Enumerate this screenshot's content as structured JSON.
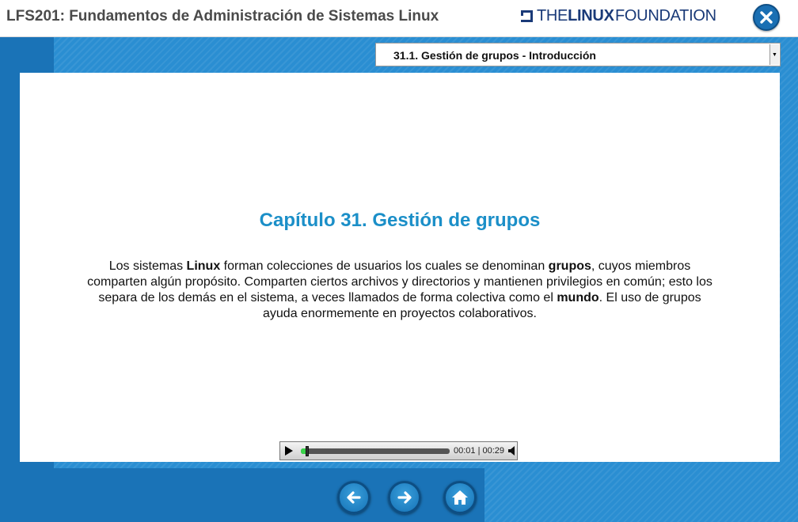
{
  "header": {
    "course_title": "LFS201: Fundamentos de Administración de Sistemas Linux",
    "logo": {
      "prefix": "THE",
      "brand": "LINUX",
      "suffix": "FOUNDATION"
    },
    "close_icon": "close-icon"
  },
  "section_select": {
    "selected": "31.1. Gestión de grupos - Introducción"
  },
  "content": {
    "chapter_title": "Capítulo 31. Gestión de grupos",
    "paragraph": [
      {
        "text": "Los sistemas ",
        "bold": false
      },
      {
        "text": "Linux",
        "bold": true
      },
      {
        "text": " forman colecciones de usuarios los cuales se denominan ",
        "bold": false
      },
      {
        "text": "grupos",
        "bold": true
      },
      {
        "text": ", cuyos miembros comparten algún propósito. Comparten ciertos archivos y directorios y mantienen privilegios en común; esto los separa de los demás en el sistema, a veces llamados de forma colectiva como el ",
        "bold": false
      },
      {
        "text": "mundo",
        "bold": true
      },
      {
        "text": ". El uso de grupos ayuda enormemente en proyectos colaborativos.",
        "bold": false
      }
    ]
  },
  "audio_player": {
    "current_time": "00:01",
    "separator": " | ",
    "duration": "00:29",
    "progress_fraction": 0.04,
    "icons": {
      "play": "play-icon",
      "volume": "volume-icon"
    }
  },
  "navigation": {
    "back_icon": "arrow-left-icon",
    "forward_icon": "arrow-right-icon",
    "home_icon": "home-icon"
  },
  "colors": {
    "accent_title": "#1b8fc8",
    "background_blue": "#2a8ed2",
    "logo_navy": "#1a3a78",
    "progress_green": "#39d44a"
  }
}
